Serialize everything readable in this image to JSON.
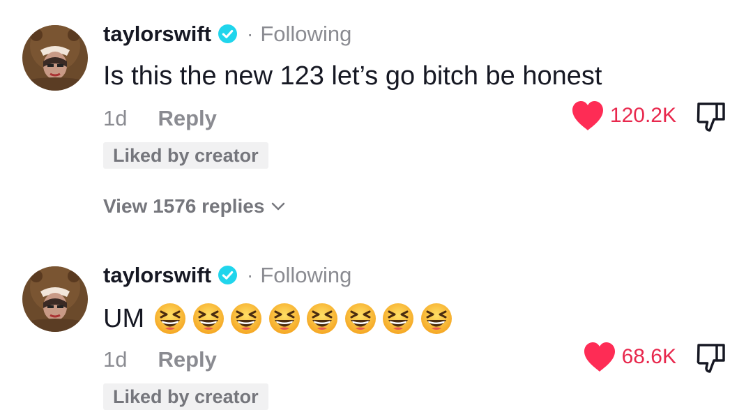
{
  "comments": [
    {
      "username": "taylorswift",
      "follow_status": "Following",
      "separator": "·",
      "text": "Is this the new 123 let’s go bitch be honest",
      "emoji_count": 0,
      "time": "1d",
      "reply_label": "Reply",
      "badge": "Liked by creator",
      "likes": "120.2K",
      "view_replies": "View 1576 replies"
    },
    {
      "username": "taylorswift",
      "follow_status": "Following",
      "separator": "·",
      "text": "UM",
      "emoji_count": 8,
      "time": "1d",
      "reply_label": "Reply",
      "badge": "Liked by creator",
      "likes": "68.6K"
    }
  ],
  "icons": {
    "verified": "verified-badge-icon",
    "like": "heart-icon",
    "dislike": "thumbs-down-icon",
    "emoji": "grinning-squinting-face-emoji",
    "chevron": "chevron-down-icon"
  },
  "colors": {
    "verified": "#20d5ec",
    "like": "#fe2c55",
    "muted": "#8a8b91",
    "badge_bg": "#f1f1f2"
  }
}
